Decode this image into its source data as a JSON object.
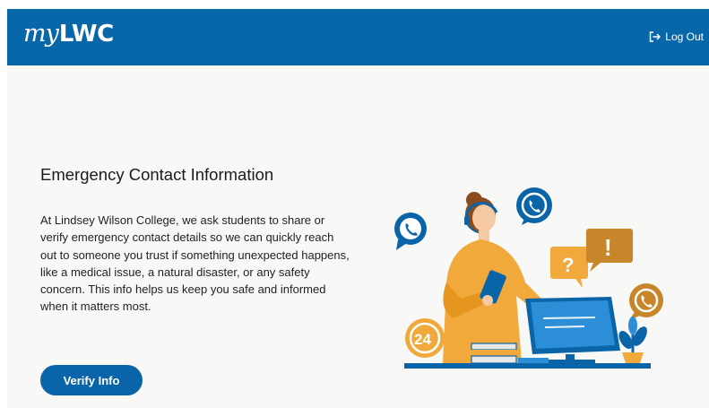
{
  "header": {
    "logo_script": "my",
    "logo_bold": "LWC",
    "logout_label": "Log Out",
    "logout_icon": "logout-icon"
  },
  "main": {
    "title": "Emergency Contact Information",
    "description": "At Lindsey Wilson College, we ask students to share or verify emergency contact details so we can quickly reach out to someone you trust if something unexpected happens, like a medical issue, a natural disaster, or any safety concern. This info helps us keep you safe and informed when it matters most.",
    "verify_button": "Verify Info"
  },
  "illustration": {
    "badge_24": "24",
    "question_mark": "?",
    "exclamation_mark": "!"
  },
  "colors": {
    "header_blue": "#0767a9",
    "button_blue": "#0a64a8",
    "accent_orange": "#f2a93b",
    "page_background": "#f8f8f7"
  }
}
